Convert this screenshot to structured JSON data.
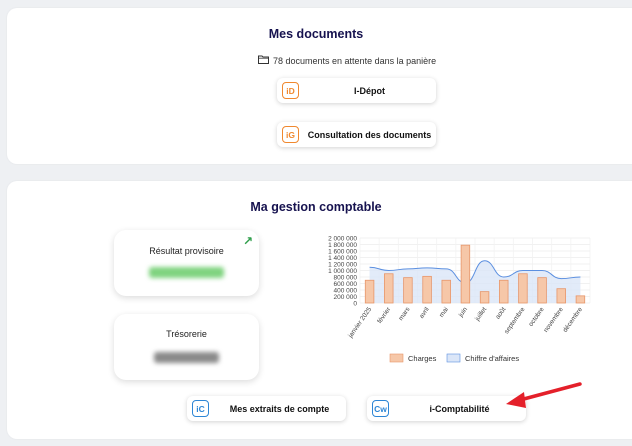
{
  "documents": {
    "title": "Mes documents",
    "pending_text": "78 documents en attente dans la panière",
    "pending_icon": "folder-icon",
    "buttons": [
      {
        "icon_text": "iD",
        "label": "I-Dépot",
        "color": "#f0882e"
      },
      {
        "icon_text": "iG",
        "label": "Consultation des documents",
        "color": "#f0882e"
      }
    ]
  },
  "compta": {
    "title": "Ma gestion comptable",
    "kpis": [
      {
        "label": "Résultat provisoire",
        "value_color": "#7fd37f",
        "trend_icon": "trend-up-arrow-icon"
      },
      {
        "label": "Trésorerie",
        "value_color": "#8a8a8a"
      }
    ],
    "buttons": [
      {
        "icon_text": "iC",
        "label": "Mes extraits de compte",
        "color": "#2d86d6"
      },
      {
        "icon_text": "Cw",
        "label": "i-Comptabilité",
        "color": "#2d86d6"
      }
    ]
  },
  "chart_data": {
    "type": "bar",
    "categories": [
      "janvier 2025",
      "février",
      "mars",
      "avril",
      "mai",
      "juin",
      "juillet",
      "août",
      "septembre",
      "octobre",
      "novembre",
      "décembre"
    ],
    "series": [
      {
        "name": "Charges",
        "type": "bar",
        "color": "#f6c7a8",
        "stroke": "#e8966a",
        "values": [
          700000,
          900000,
          780000,
          820000,
          700000,
          1780000,
          350000,
          700000,
          900000,
          780000,
          440000,
          220000
        ]
      },
      {
        "name": "Chiffre d'affaires",
        "type": "area",
        "color": "#dbe6f8",
        "stroke": "#5b8fe0",
        "values": [
          1100000,
          1000000,
          1050000,
          1080000,
          1050000,
          620000,
          1300000,
          800000,
          1000000,
          1000000,
          750000,
          800000
        ]
      }
    ],
    "ylim": [
      0,
      2000000
    ],
    "yticks": [
      "2 000 000",
      "1 800 000",
      "1 600 000",
      "1 400 000",
      "1 200 000",
      "1 000 000",
      "800 000",
      "600 000",
      "400 000",
      "200 000",
      "0"
    ],
    "legend_position": "bottom",
    "grid": true
  }
}
